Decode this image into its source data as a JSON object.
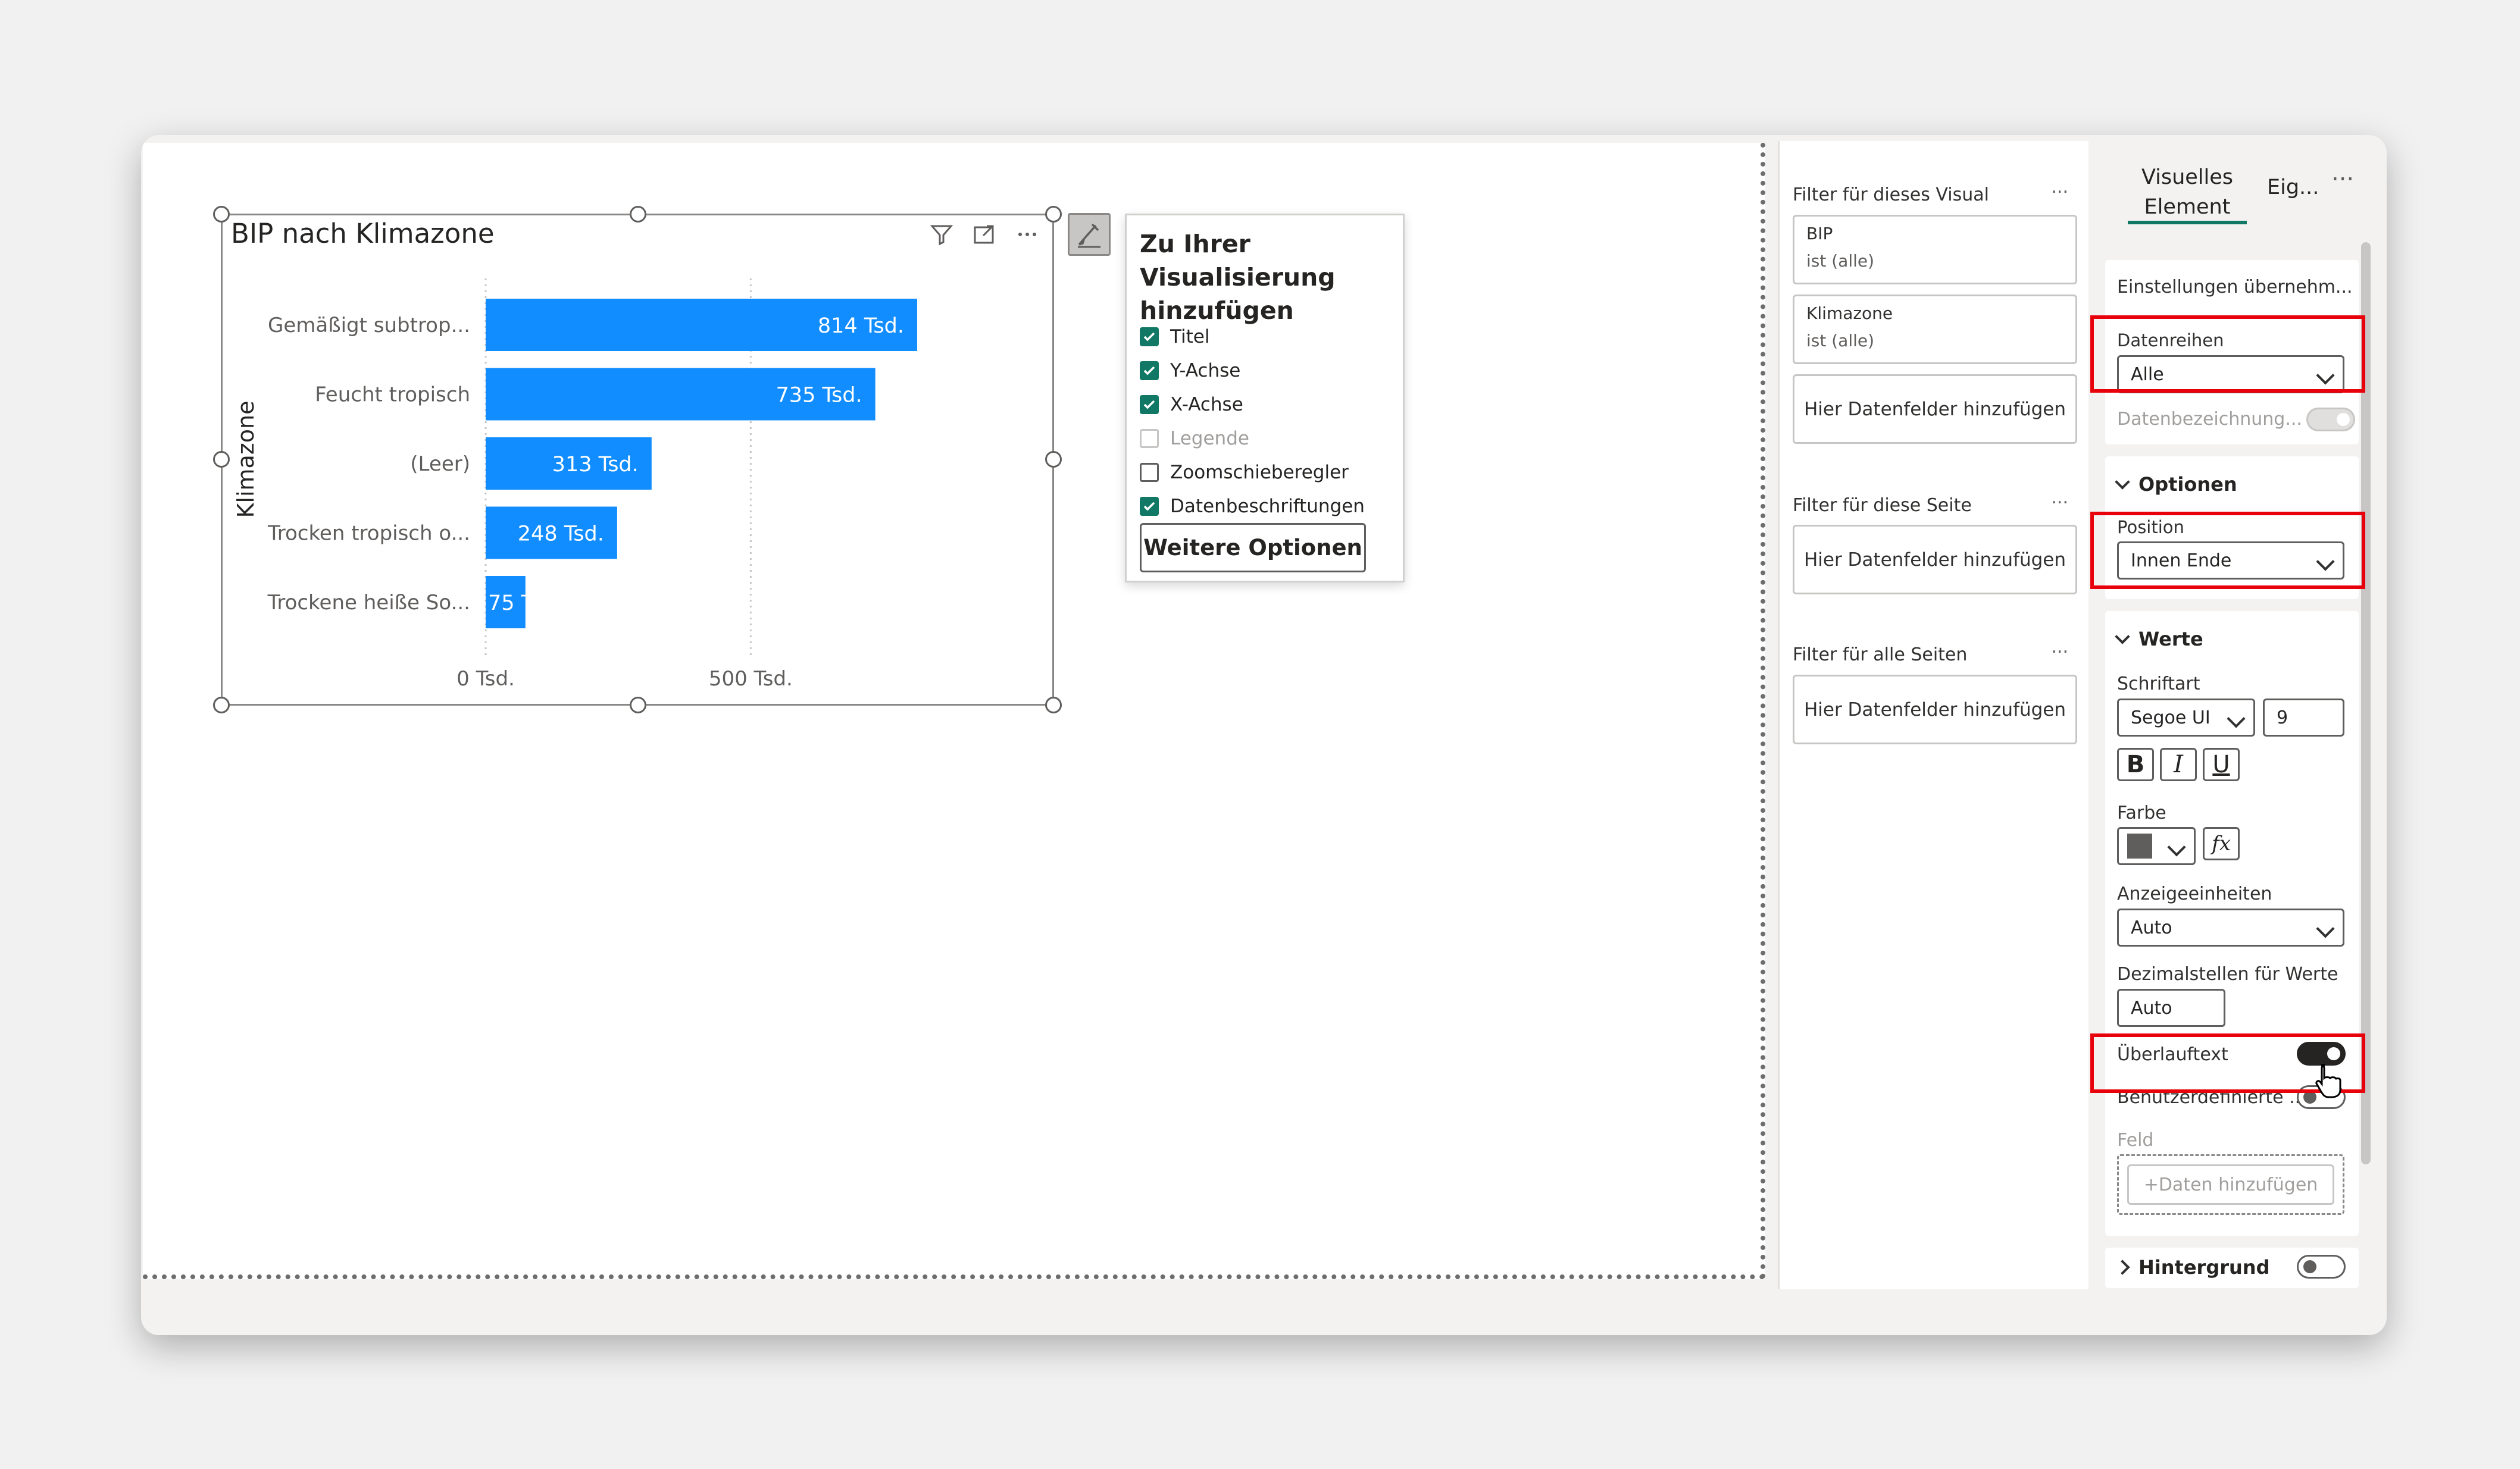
{
  "visual": {
    "title": "BIP nach Klimazone",
    "y_axis_title": "Klimazone"
  },
  "chart_data": {
    "type": "bar",
    "orientation": "horizontal",
    "title": "BIP nach Klimazone",
    "ylabel": "Klimazone",
    "xlabel": "",
    "categories": [
      "Gemäßigt subtrop...",
      "Feucht tropisch",
      "(Leer)",
      "Trocken tropisch o...",
      "Trockene heiße So..."
    ],
    "values": [
      814,
      735,
      313,
      248,
      75
    ],
    "data_labels": [
      "814 Tsd.",
      "735 Tsd.",
      "313 Tsd.",
      "248 Tsd.",
      "75 T"
    ],
    "x_ticks": [
      {
        "value": 0,
        "label": "0 Tsd."
      },
      {
        "value": 500,
        "label": "500 Tsd."
      }
    ],
    "xlim": [
      0,
      814
    ],
    "color": "#118DFF",
    "grid": "vertical dotted"
  },
  "popup": {
    "title": "Zu Ihrer Visualisierung hinzufügen",
    "items": [
      {
        "label": "Titel",
        "checked": true,
        "disabled": false
      },
      {
        "label": "Y-Achse",
        "checked": true,
        "disabled": false
      },
      {
        "label": "X-Achse",
        "checked": true,
        "disabled": false
      },
      {
        "label": "Legende",
        "checked": false,
        "disabled": true
      },
      {
        "label": "Zoomschieberegler",
        "checked": false,
        "disabled": false
      },
      {
        "label": "Datenbeschriftungen",
        "checked": true,
        "disabled": false
      }
    ],
    "button": "Weitere Optionen"
  },
  "filters": {
    "visual_header": "Filter für dieses Visual",
    "cards": [
      {
        "field": "BIP",
        "value": "ist (alle)"
      },
      {
        "field": "Klimazone",
        "value": "ist (alle)"
      }
    ],
    "add_label": "Hier Datenfelder hinzufügen",
    "page_header": "Filter für diese Seite",
    "all_header": "Filter für alle Seiten",
    "dots": "..."
  },
  "props": {
    "tab_visual": "Visuelles Element",
    "tab_props": "Eig...",
    "dots": "...",
    "apply_settings": "Einstellungen übernehm...",
    "series_label": "Datenreihen",
    "series_value": "Alle",
    "data_label_label": "Datenbezeichnung...",
    "options_header": "Optionen",
    "position_label": "Position",
    "position_value": "Innen Ende",
    "values_header": "Werte",
    "font_label": "Schriftart",
    "font_value": "Segoe UI",
    "font_size": "9",
    "bold": "B",
    "italic": "I",
    "underline": "U",
    "color_label": "Farbe",
    "color_value": "#605e5c",
    "fx": "fx",
    "units_label": "Anzeigeeinheiten",
    "units_value": "Auto",
    "decimals_label": "Dezimalstellen für Werte",
    "decimals_value": "Auto",
    "overflow_label": "Überlauftext",
    "custom_label": "Benutzerdefinierte ...",
    "field_label": "Feld",
    "add_data": "+Daten hinzufügen",
    "background_header": "Hintergrund"
  }
}
